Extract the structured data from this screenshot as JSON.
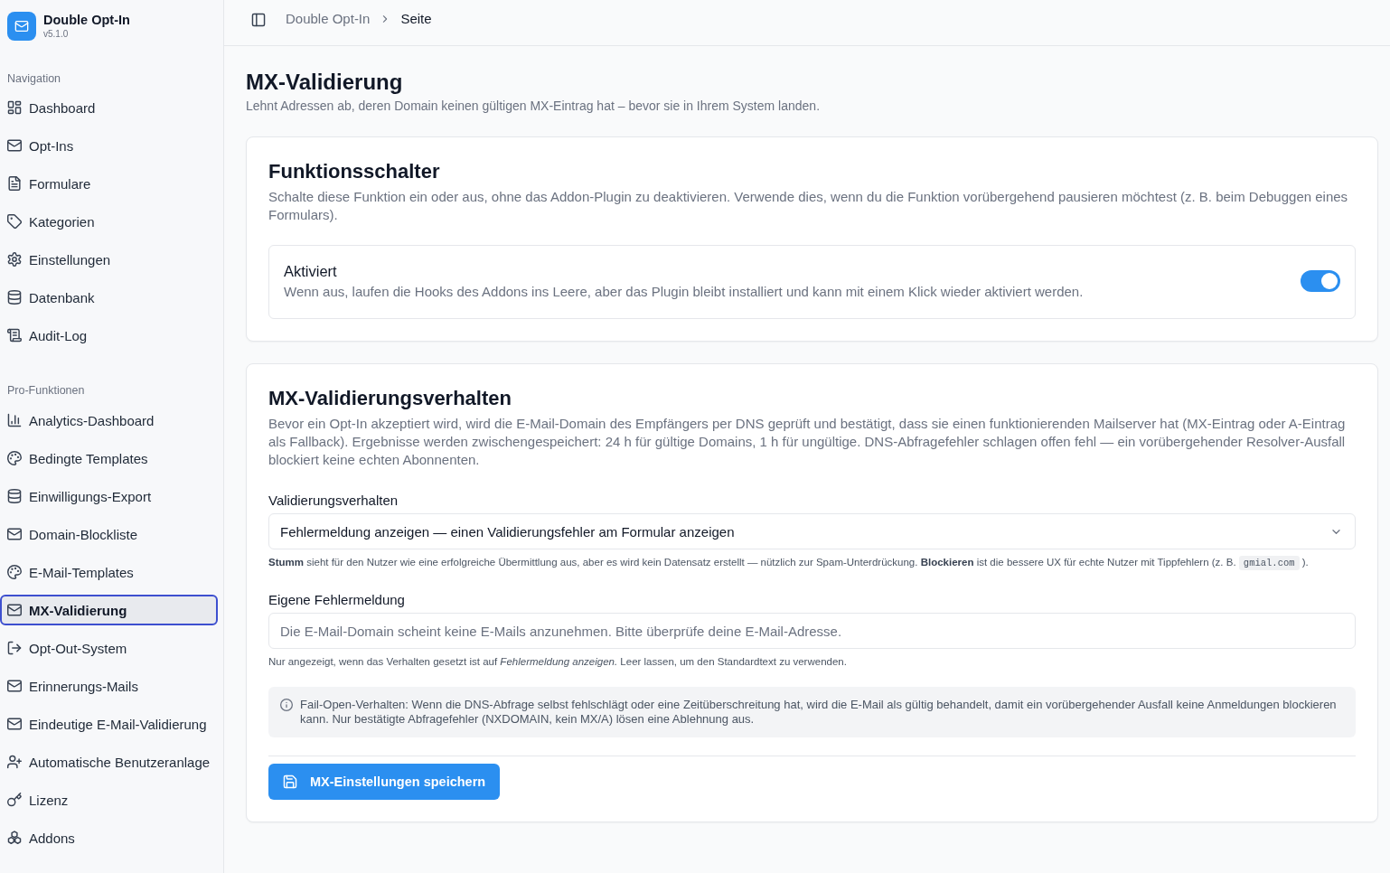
{
  "app": {
    "name": "Double Opt-In",
    "version": "v5.1.0"
  },
  "sidebar": {
    "groups": [
      {
        "label": "Navigation",
        "items": [
          {
            "label": "Dashboard",
            "selected": false
          },
          {
            "label": "Opt-Ins",
            "selected": false
          },
          {
            "label": "Formulare",
            "selected": false
          },
          {
            "label": "Kategorien",
            "selected": false
          },
          {
            "label": "Einstellungen",
            "selected": false
          },
          {
            "label": "Datenbank",
            "selected": false
          },
          {
            "label": "Audit-Log",
            "selected": false
          }
        ]
      },
      {
        "label": "Pro-Funktionen",
        "items": [
          {
            "label": "Analytics-Dashboard",
            "selected": false
          },
          {
            "label": "Bedingte Templates",
            "selected": false
          },
          {
            "label": "Einwilligungs-Export",
            "selected": false
          },
          {
            "label": "Domain-Blockliste",
            "selected": false
          },
          {
            "label": "E-Mail-Templates",
            "selected": false
          },
          {
            "label": "MX-Validierung",
            "selected": true
          },
          {
            "label": "Opt-Out-System",
            "selected": false
          },
          {
            "label": "Erinnerungs-Mails",
            "selected": false
          },
          {
            "label": "Eindeutige E-Mail-Validierung",
            "selected": false
          },
          {
            "label": "Automatische Benutzeranlage",
            "selected": false
          },
          {
            "label": "Lizenz",
            "selected": false
          },
          {
            "label": "Addons",
            "selected": false
          }
        ]
      }
    ]
  },
  "breadcrumb": [
    "Double Opt-In",
    "Seite"
  ],
  "page": {
    "title": "MX-Validierung",
    "subtitle": "Lehnt Adressen ab, deren Domain keinen gültigen MX-Eintrag hat – bevor sie in Ihrem System landen."
  },
  "feature_card": {
    "title": "Funktionsschalter",
    "description": "Schalte diese Funktion ein oder aus, ohne das Addon-Plugin zu deaktivieren. Verwende dies, wenn du die Funktion vorübergehend pausieren möchtest (z. B. beim Debuggen eines Formulars).",
    "toggle": {
      "label": "Aktiviert",
      "description": "Wenn aus, laufen die Hooks des Addons ins Leere, aber das Plugin bleibt installiert und kann mit einem Klick wieder aktiviert werden.",
      "on": true
    }
  },
  "behavior_card": {
    "title": "MX-Validierungsverhalten",
    "description": "Bevor ein Opt-In akzeptiert wird, wird die E-Mail-Domain des Empfängers per DNS geprüft und bestätigt, dass sie einen funktionierenden Mailserver hat (MX-Eintrag oder A-Eintrag als Fallback). Ergebnisse werden zwischengespeichert: 24 h für gültige Domains, 1 h für ungültige. DNS-Abfragefehler schlagen offen fehl — ein vorübergehender Resolver-Ausfall blockiert keine echten Abonnenten.",
    "fields": [
      {
        "kind": "select",
        "label": "Validierungsverhalten",
        "value": "Fehlermeldung anzeigen — einen Validierungsfehler am Formular anzeigen",
        "help": [
          {
            "kind": "text",
            "text": "**Stumm** sieht für den Nutzer wie eine erfolgreiche Übermittlung aus, aber es wird kein Datensatz erstellt — nützlich zur Spam-Unterdrückung. **Blockieren** ist die bessere UX für echte Nutzer mit Tippfehlern (z. B. "
          },
          {
            "kind": "code",
            "text": "gmial.com"
          },
          {
            "kind": "text",
            "text": " )."
          }
        ]
      },
      {
        "kind": "text",
        "label": "Eigene Fehlermeldung",
        "placeholder": "Die E-Mail-Domain scheint keine E-Mails anzunehmen. Bitte überprüfe deine E-Mail-Adresse.",
        "help": [
          {
            "kind": "text",
            "text": "Nur angezeigt, wenn das Verhalten gesetzt ist auf *Fehlermeldung anzeigen.* Leer lassen, um den Standardtext zu verwenden."
          }
        ]
      }
    ],
    "notice": "Fail-Open-Verhalten: Wenn die DNS-Abfrage selbst fehlschlägt oder eine Zeitüberschreitung hat, wird die E-Mail als gültig behandelt, damit ein vorübergehender Ausfall keine Anmeldungen blockieren kann. Nur bestätigte Abfragefehler (NXDOMAIN, kein MX/A) lösen eine Ablehnung aus.",
    "save_button": "MX-Einstellungen speichern"
  }
}
